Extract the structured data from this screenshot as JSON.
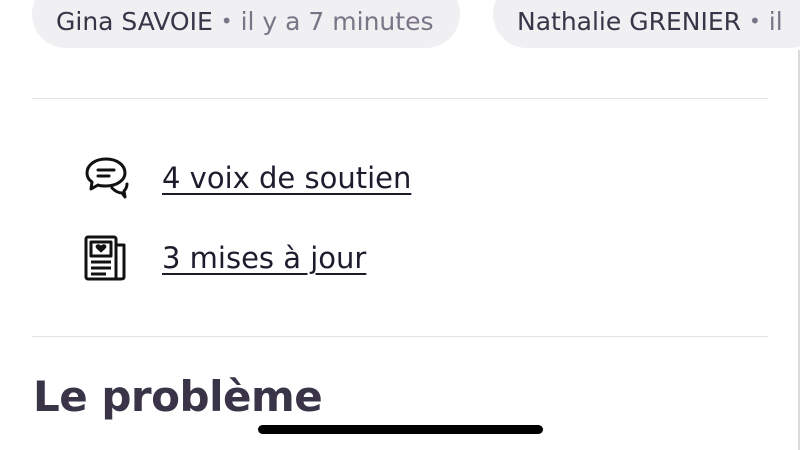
{
  "signers": [
    {
      "name": "Gina SAVOIE",
      "time": "il y a 7 minutes"
    },
    {
      "name": "Nathalie GRENIER",
      "time": "il"
    }
  ],
  "separator": "•",
  "stats": {
    "supporters": {
      "label": "4 voix de soutien",
      "icon": "speech-bubbles-icon"
    },
    "updates": {
      "label": "3 mises à jour",
      "icon": "newspaper-heart-icon"
    }
  },
  "section": {
    "title": "Le problème"
  },
  "colors": {
    "chip_bg": "#f0eff2",
    "text": "#1f1b2d",
    "muted": "#7a7487",
    "heading": "#3a3448"
  }
}
